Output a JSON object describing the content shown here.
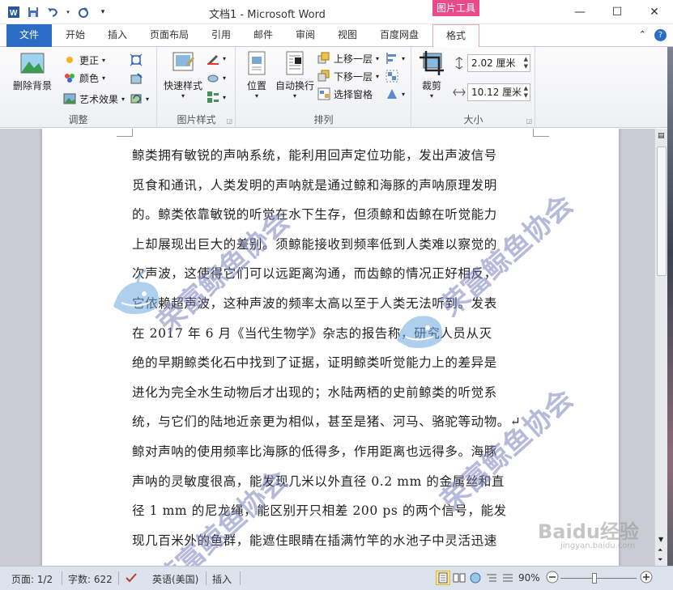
{
  "window": {
    "title": "文档1 - Microsoft Word",
    "context_group": "图片工具",
    "controls": [
      "minimize",
      "maximize",
      "close"
    ]
  },
  "quick_access": [
    "word-icon",
    "save-icon",
    "undo-icon",
    "redo-icon",
    "customize-icon"
  ],
  "tabs": {
    "file": "文件",
    "items": [
      "开始",
      "插入",
      "页面布局",
      "引用",
      "邮件",
      "审阅",
      "视图",
      "百度网盘"
    ],
    "context": "格式"
  },
  "ribbon": {
    "adjust": {
      "remove_bg": "删除背景",
      "corrections": "更正",
      "color": "颜色",
      "artistic": "艺术效果",
      "label": "调整"
    },
    "picture_styles": {
      "quick_styles": "快速样式",
      "label": "图片样式"
    },
    "arrange": {
      "position": "位置",
      "wrap_text": "自动换行",
      "bring_forward": "上移一层",
      "send_backward": "下移一层",
      "selection_pane": "选择窗格",
      "label": "排列"
    },
    "size": {
      "crop": "裁剪",
      "height": "2.02 厘米",
      "width": "10.12 厘米",
      "label": "大小"
    }
  },
  "document": {
    "lines": [
      "鲸类拥有敏锐的声呐系统，能利用回声定位功能，发出声波信号",
      "觅食和通讯，人类发明的声呐就是通过鲸和海豚的声呐原理发明",
      "的。鲸类依靠敏锐的听觉在水下生存，但须鲸和齿鲸在听觉能力",
      "上却展现出巨大的差别。须鲸能接收到频率低到人类难以察觉的",
      "次声波，这使得它们可以远距离沟通，而齿鲸的情况正好相反，",
      "它依赖超声波，这种声波的频率太高以至于人类无法听到。发表",
      "在 2017 年 6 月《当代生物学》杂志的报告称，研究人员从灭",
      "绝的早期鲸类化石中找到了证据，证明鲸类听觉能力上的差异是",
      "进化为完全水生动物后才出现的；水陆两栖的史前鲸类的听觉系",
      "统，与它们的陆地近亲更为相似，甚至是猪、河马、骆驼等动物。↵",
      "鲸对声呐的使用频率比海豚的低得多，作用距离也远得多。海豚",
      "声呐的灵敏度很高，能发现几米以外直径 0.2 mm 的金属丝和直",
      "径 1 mm 的尼龙绳，能区别开只相差 200 ps 的两个信号，能发",
      "现几百米外的鱼群，能遮住眼睛在插满竹竿的水池子中灵活迅速"
    ],
    "watermark_text": "荣富鲸鱼协会",
    "baidu_watermark": "Baidu经验",
    "baidu_url": "jingyan.baidu.com"
  },
  "status": {
    "page": "页面: 1/2",
    "words": "字数: 622",
    "language": "英语(美国)",
    "mode": "插入",
    "zoom": "90%"
  }
}
